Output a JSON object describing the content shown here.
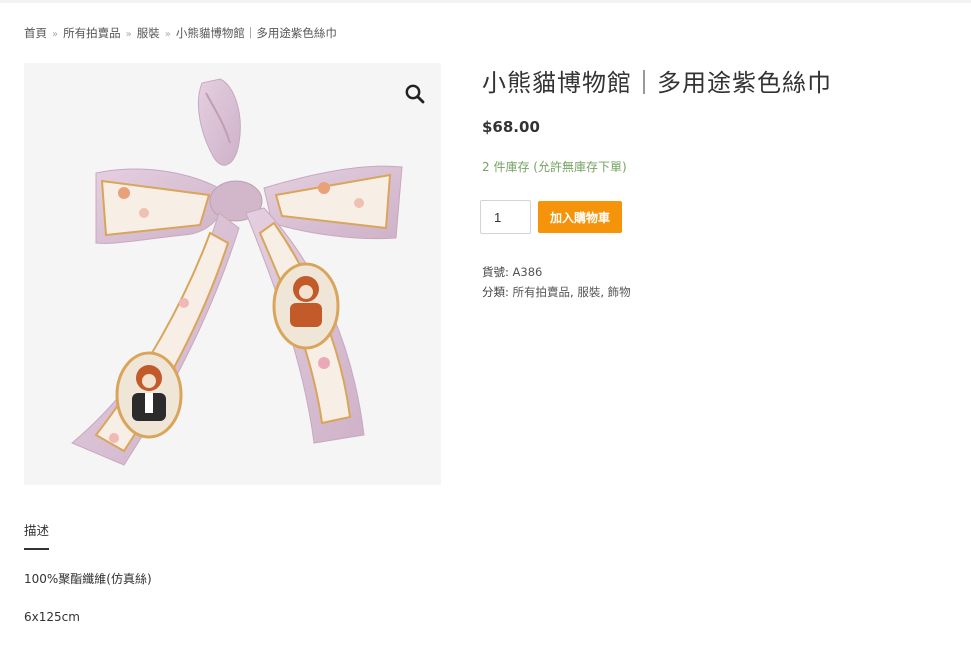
{
  "breadcrumb": {
    "items": [
      "首頁",
      "所有拍賣品",
      "服裝",
      "小熊貓博物館｜多用途紫色絲巾"
    ],
    "separator": "»"
  },
  "gallery": {
    "zoom_icon": "magnifier-icon",
    "image_alt": "紫色絲巾 小熊貓圖案"
  },
  "product": {
    "title": "小熊貓博物館｜多用途紫色絲巾",
    "price": "$68.00",
    "stock": "2 件庫存 (允許無庫存下單)",
    "quantity": "1",
    "add_to_cart": "加入購物車",
    "sku_label": "貨號:",
    "sku": "A386",
    "category_label": "分類:",
    "categories": [
      "所有拍賣品",
      "服裝",
      "飾物"
    ],
    "category_sep": ", "
  },
  "tabs": {
    "description_label": "描述"
  },
  "description": {
    "line1": "100%聚酯纖維(仿真絲)",
    "line2": "6x125cm"
  },
  "colors": {
    "accent": "#f5940b",
    "stock": "#77a464",
    "scarf": "#d9bfd3"
  }
}
